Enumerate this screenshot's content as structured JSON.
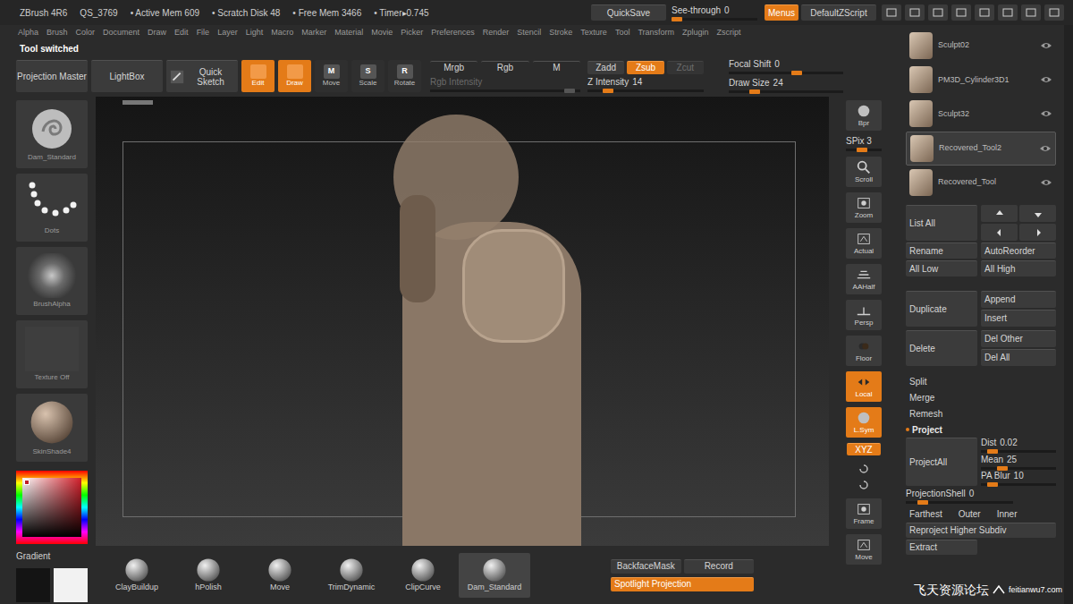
{
  "title_bar": {
    "app": "ZBrush 4R6",
    "stats": [
      "QS_3769",
      "• Active Mem 609",
      "• Scratch Disk 48",
      "• Free Mem 3466",
      "• Timer▸0.745"
    ],
    "quicksave": "QuickSave",
    "see_through": {
      "label": "See-through",
      "value": "0",
      "level": 0
    },
    "menus": {
      "label": "Menus",
      "selected": true
    },
    "script": "DefaultZScript"
  },
  "menu_bar": [
    "Alpha",
    "Brush",
    "Color",
    "Document",
    "Draw",
    "Edit",
    "File",
    "Layer",
    "Light",
    "Macro",
    "Marker",
    "Material",
    "Movie",
    "Picker",
    "Preferences",
    "Render",
    "Stencil",
    "Stroke",
    "Texture",
    "Tool",
    "Transform",
    "Zplugin",
    "Zscript"
  ],
  "notice": "Tool switched",
  "top_shelf": {
    "projection_master": "Projection Master",
    "lightbox": "LightBox",
    "quick_sketch": "Quick Sketch",
    "modes": [
      {
        "label": "Edit",
        "key": "",
        "selected": true
      },
      {
        "label": "Draw",
        "key": "",
        "selected": true
      },
      {
        "label": "Move",
        "key": "M",
        "selected": false
      },
      {
        "label": "Scale",
        "key": "S",
        "selected": false
      },
      {
        "label": "Rotate",
        "key": "R",
        "selected": false
      }
    ],
    "color_modes": [
      {
        "label": "Mrgb",
        "selected": false
      },
      {
        "label": "Rgb",
        "selected": false
      },
      {
        "label": "M",
        "selected": false
      }
    ],
    "rgb_intensity": {
      "label": "Rgb Intensity",
      "disabled": true,
      "level": 0.96
    },
    "z_modes": [
      {
        "label": "Zadd",
        "selected": false,
        "disabled": false
      },
      {
        "label": "Zsub",
        "selected": true,
        "disabled": false
      },
      {
        "label": "Zcut",
        "selected": false,
        "disabled": true
      }
    ],
    "z_intensity": {
      "label": "Z Intensity",
      "value": "14",
      "level": 0.14
    },
    "focal_shift": {
      "label": "Focal Shift",
      "value": "0",
      "level": 0.6
    },
    "draw_size": {
      "label": "Draw Size",
      "value": "24",
      "level": 0.2
    }
  },
  "left_shelf": {
    "tools": [
      {
        "label": "Dam_Standard",
        "kind": "brush"
      },
      {
        "label": "Dots",
        "kind": "stroke"
      },
      {
        "label": "BrushAlpha",
        "kind": "alpha"
      },
      {
        "label": "Texture Off",
        "kind": "texture"
      },
      {
        "label": "SkinShade4",
        "kind": "material"
      }
    ],
    "gradient": {
      "label": "Gradient",
      "swatches": [
        {
          "color": "#141414"
        },
        {
          "color": "#f2f2f2"
        }
      ]
    }
  },
  "right_shelf": [
    {
      "label": "Bpr",
      "kind": "button",
      "selected": false
    },
    {
      "label": "SPix 3",
      "kind": "slider",
      "level": 0.43
    },
    {
      "label": "Scroll",
      "kind": "button",
      "selected": false
    },
    {
      "label": "Zoom",
      "kind": "button",
      "selected": false
    },
    {
      "label": "Actual",
      "kind": "button",
      "selected": false
    },
    {
      "label": "AAHalf",
      "kind": "button",
      "selected": false
    },
    {
      "label": "Persp",
      "kind": "button",
      "selected": false
    },
    {
      "label": "Floor",
      "kind": "button",
      "selected": false
    },
    {
      "label": "Local",
      "kind": "button",
      "selected": true
    },
    {
      "label": "L.Sym",
      "kind": "button",
      "selected": true
    },
    {
      "label": "XYZ",
      "kind": "toggle",
      "selected": true
    },
    {
      "label": "",
      "kind": "rotate",
      "selected": false
    },
    {
      "label": "Frame",
      "kind": "button",
      "selected": false
    },
    {
      "label": "Move",
      "kind": "button",
      "selected": false
    }
  ],
  "subtools": [
    {
      "name": "Sculpt02",
      "selected": false,
      "visible": true
    },
    {
      "name": "PM3D_Cylinder3D1",
      "selected": false,
      "visible": true
    },
    {
      "name": "Sculpt32",
      "selected": false,
      "visible": true
    },
    {
      "name": "Recovered_Tool2",
      "selected": true,
      "visible": true
    },
    {
      "name": "Recovered_Tool",
      "selected": false,
      "visible": true
    }
  ],
  "subtool_actions": {
    "list_all": "List All",
    "rename": "Rename",
    "auto_reorder": "AutoReorder",
    "all_low": "All Low",
    "all_high": "All High",
    "duplicate": "Duplicate",
    "append": "Append",
    "insert": "Insert",
    "delete": "Delete",
    "del_other": "Del Other",
    "del_all": "Del All",
    "split": "Split",
    "merge": "Merge",
    "remesh": "Remesh",
    "project": {
      "label": "Project",
      "expanded": true
    },
    "project_all": "ProjectAll",
    "sliders": [
      {
        "label": "Dist",
        "value": "0.02",
        "level": 0.1
      },
      {
        "label": "Mean",
        "value": "25",
        "level": 0.25
      },
      {
        "label": "PA Blur",
        "value": "10",
        "level": 0.1
      }
    ],
    "projection_shell": {
      "label": "ProjectionShell",
      "value": "0",
      "level": 0.12
    },
    "shell_modes": [
      "Farthest",
      "Outer",
      "Inner"
    ],
    "reproject": "Reproject Higher Subdiv",
    "extract": "Extract"
  },
  "bottom_shelf": {
    "brushes": [
      {
        "label": "ClayBuildup",
        "selected": false
      },
      {
        "label": "hPolish",
        "selected": false
      },
      {
        "label": "Move",
        "selected": false
      },
      {
        "label": "TrimDynamic",
        "selected": false
      },
      {
        "label": "ClipCurve",
        "selected": false
      },
      {
        "label": "Dam_Standard",
        "selected": true
      }
    ],
    "backface_mask": {
      "label": "BackfaceMask",
      "selected": false
    },
    "record": "Record",
    "spotlight": {
      "label": "Spotlight Projection",
      "selected": true
    }
  },
  "watermark": {
    "name": "飞天资源论坛",
    "url": "feitianwu7.com"
  }
}
